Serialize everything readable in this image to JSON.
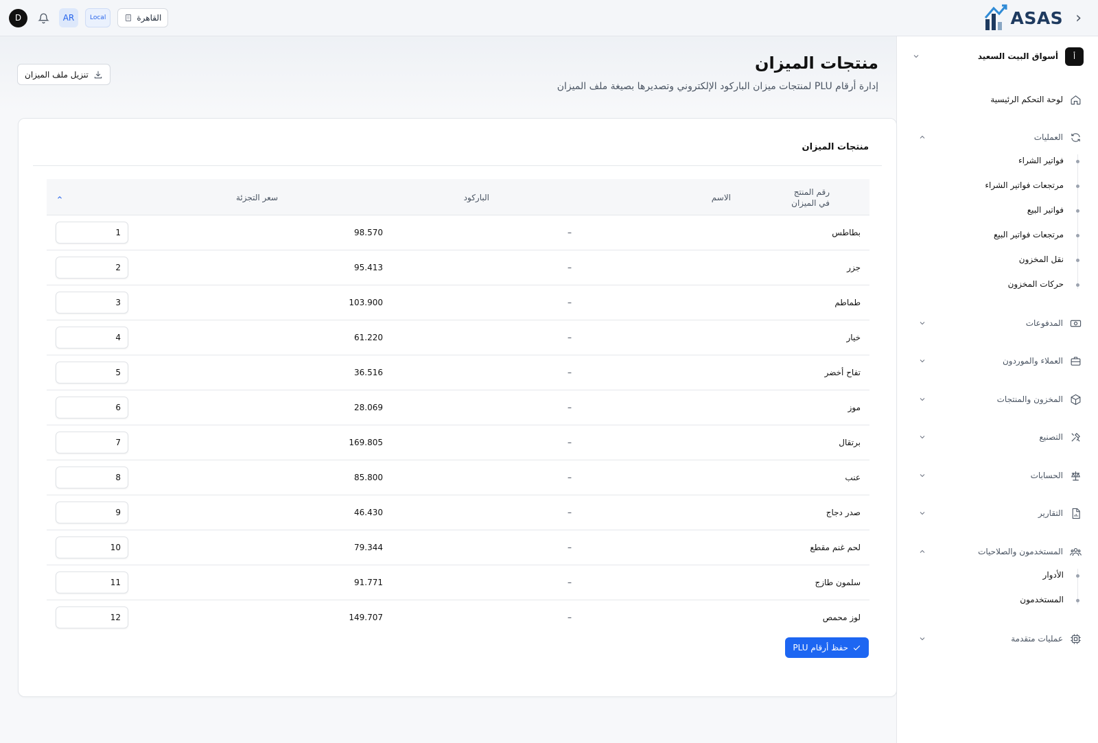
{
  "app": {
    "logo_text": "ASAS"
  },
  "topbar": {
    "avatar_initial": "D",
    "language": "AR",
    "mode": "Local",
    "branch": "القاهرة"
  },
  "sidebar": {
    "company": {
      "logo": "أ",
      "name": "أسواق البيت السعيد"
    },
    "items": [
      {
        "label": "لوحة التحكم الرئيسية",
        "icon": "home-icon"
      },
      {
        "label": "العمليات",
        "icon": "refresh-icon",
        "expanded": true,
        "children": [
          "فواتير الشراء",
          "مرتجعات فواتير الشراء",
          "فواتير البيع",
          "مرتجعات فواتير البيع",
          "نقل المخزون",
          "حركات المخزون"
        ]
      },
      {
        "label": "المدفوعات",
        "icon": "money-icon"
      },
      {
        "label": "العملاء والموردون",
        "icon": "briefcase-icon"
      },
      {
        "label": "المخزون والمنتجات",
        "icon": "box-icon"
      },
      {
        "label": "التصنيع",
        "icon": "tools-icon"
      },
      {
        "label": "الحسابات",
        "icon": "scale-icon"
      },
      {
        "label": "التقارير",
        "icon": "report-icon"
      },
      {
        "label": "المستخدمون والصلاحيات",
        "icon": "users-icon",
        "expanded": true,
        "children": [
          "الأدوار",
          "المستخدمون"
        ]
      },
      {
        "label": "عمليات متقدمة",
        "icon": "chip-icon"
      }
    ]
  },
  "page": {
    "title": "منتجات الميزان",
    "subtitle": "إدارة أرقام PLU لمنتجات ميزان الباركود الإلكتروني وتصديرها بصيغة ملف الميزان",
    "download_label": "تنزيل ملف الميزان"
  },
  "card": {
    "title": "منتجات الميزان",
    "columns": {
      "name": "الاسم",
      "barcode": "الباركود",
      "price": "سعر التجزئة",
      "plu": "رقم المنتج في الميزان"
    },
    "rows": [
      {
        "name": "بطاطس",
        "barcode": "–",
        "price": "98.570",
        "plu": "1"
      },
      {
        "name": "جزر",
        "barcode": "–",
        "price": "95.413",
        "plu": "2"
      },
      {
        "name": "طماطم",
        "barcode": "–",
        "price": "103.900",
        "plu": "3"
      },
      {
        "name": "خيار",
        "barcode": "–",
        "price": "61.220",
        "plu": "4"
      },
      {
        "name": "تفاح أخضر",
        "barcode": "–",
        "price": "36.516",
        "plu": "5"
      },
      {
        "name": "موز",
        "barcode": "–",
        "price": "28.069",
        "plu": "6"
      },
      {
        "name": "برتقال",
        "barcode": "–",
        "price": "169.805",
        "plu": "7"
      },
      {
        "name": "عنب",
        "barcode": "–",
        "price": "85.800",
        "plu": "8"
      },
      {
        "name": "صدر دجاج",
        "barcode": "–",
        "price": "46.430",
        "plu": "9"
      },
      {
        "name": "لحم غنم مقطع",
        "barcode": "–",
        "price": "79.344",
        "plu": "10"
      },
      {
        "name": "سلمون طازج",
        "barcode": "–",
        "price": "91.771",
        "plu": "11"
      },
      {
        "name": "لوز محمص",
        "barcode": "–",
        "price": "149.707",
        "plu": "12"
      }
    ],
    "save_label": "حفظ أرقام PLU"
  },
  "colors": {
    "accent": "#1d66f2",
    "brand": "#1e3a5f"
  }
}
